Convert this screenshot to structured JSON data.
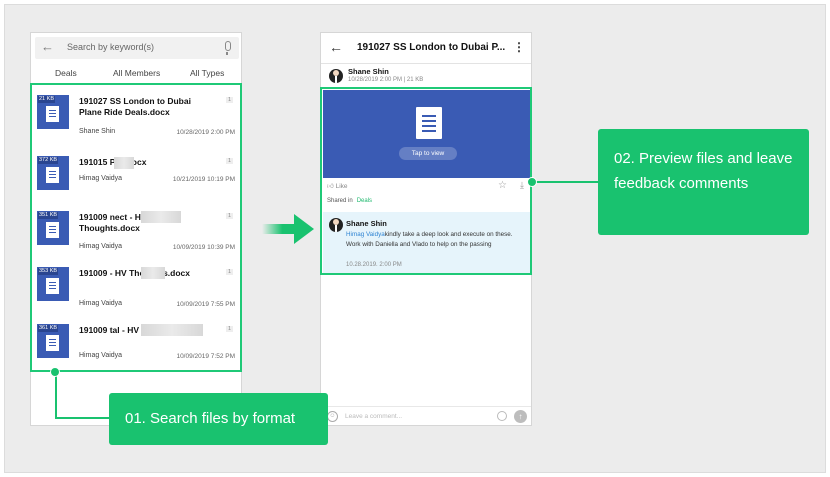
{
  "search": {
    "placeholder": "Search by keyword(s)"
  },
  "filters": {
    "deals": "Deals",
    "members": "All Members",
    "types": "All Types"
  },
  "results": [
    {
      "size": "21 KB",
      "name": "191027 SS London to Dubai Plane Ride Deals.docx",
      "user": "Shane Shin",
      "date": "10/28/2019 2:00 PM",
      "count": "1"
    },
    {
      "size": "372 KB",
      "name": "191015 Pay.docx",
      "user": "Himag Vaidya",
      "date": "10/21/2019 10:19 PM",
      "count": "1"
    },
    {
      "size": "351 KB",
      "name": "191009 nect - HV Thoughts.docx",
      "user": "Himag Vaidya",
      "date": "10/09/2019 10:39 PM",
      "count": "1"
    },
    {
      "size": "353 KB",
      "name": "191009 - HV Thoughts.docx",
      "user": "Himag Vaidya",
      "date": "10/09/2019 7:55 PM",
      "count": "1"
    },
    {
      "size": "361 KB",
      "name": "191009 tal - HV Thoughts.docx",
      "user": "Himag Vaidya",
      "date": "10/09/2019 7:52 PM",
      "count": "1"
    }
  ],
  "detail": {
    "title": "191027 SS London to Dubai P...",
    "author": "Shane Shin",
    "meta": "10/28/2019 2:00 PM  |  21 KB",
    "tap": "Tap to view",
    "like": "Like",
    "shared_label": "Shared in",
    "shared_target": "Deals",
    "comment": {
      "name": "Shane Shin",
      "mention": "Himag Vaidya",
      "text": "kindly take a deep look and execute on these.  Work with Daniella and Vlado to help on the passing",
      "date": "10.28.2019. 2:00 PM"
    },
    "comment_placeholder": "Leave a comment..."
  },
  "callouts": {
    "one": "01. Search files by format",
    "two": "02. Preview files and leave feedback comments"
  },
  "colors": {
    "accent": "#19c26f",
    "doc": "#3a5bb4",
    "mention": "#2f84d3"
  }
}
